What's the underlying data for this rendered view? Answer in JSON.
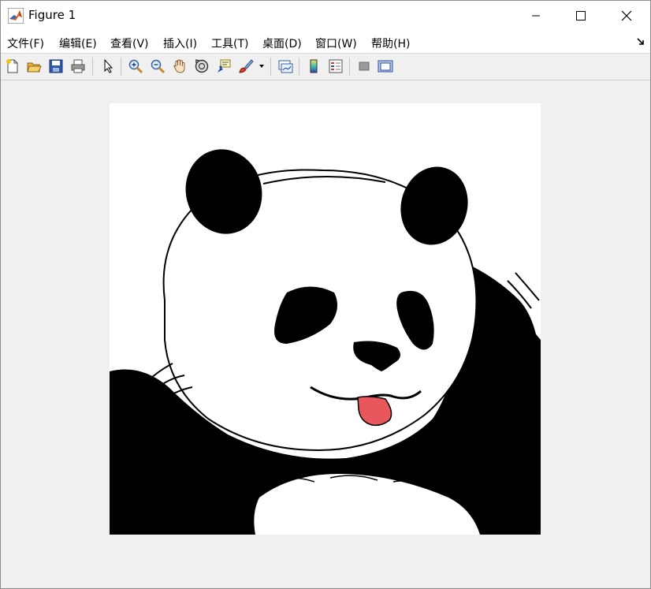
{
  "window": {
    "title": "Figure 1",
    "controls": [
      "minimize",
      "maximize",
      "close"
    ]
  },
  "menu": [
    {
      "id": "file",
      "label": "文件(F)"
    },
    {
      "id": "edit",
      "label": "编辑(E)"
    },
    {
      "id": "view",
      "label": "查看(V)"
    },
    {
      "id": "insert",
      "label": "插入(I)"
    },
    {
      "id": "tools",
      "label": "工具(T)"
    },
    {
      "id": "desktop",
      "label": "桌面(D)"
    },
    {
      "id": "window",
      "label": "窗口(W)"
    },
    {
      "id": "help",
      "label": "帮助(H)"
    }
  ],
  "toolbar": [
    "new-figure-icon",
    "open-file-icon",
    "save-icon",
    "print-icon",
    "select-pointer-icon",
    "zoom-in-icon",
    "zoom-out-icon",
    "pan-hand-icon",
    "rotate-3d-icon",
    "data-cursor-icon",
    "brush-icon",
    "brush-dropdown-icon",
    "link-plot-icon",
    "insert-colorbar-icon",
    "insert-legend-icon",
    "hide-plot-tools-icon",
    "show-plot-tools-icon"
  ],
  "figure": {
    "content": "image",
    "image_subject": "panda",
    "background_color": "#f0f0f0",
    "tongue_color": "#e8575b"
  }
}
